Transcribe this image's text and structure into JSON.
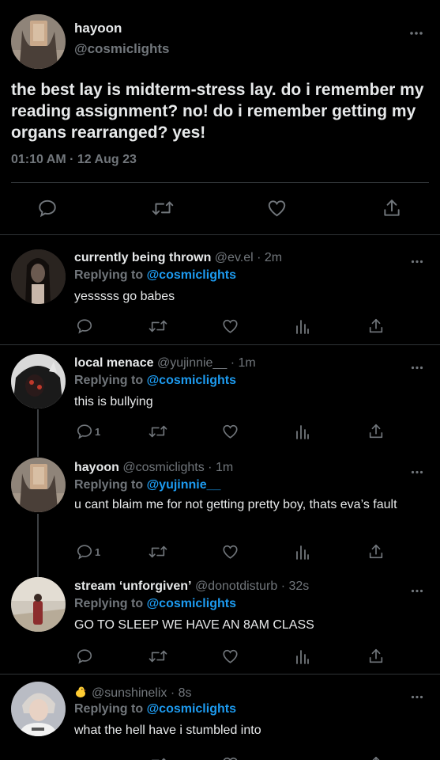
{
  "main_tweet": {
    "name": "hayoon",
    "handle": "@cosmiclights",
    "text": "the best lay is midterm-stress lay. do i remember my reading assignment? no! do i remember getting my organs rearranged? yes!",
    "time": "01:10 AM · 12 Aug 23",
    "more_icon": "more-horizontal-icon",
    "actions": [
      "reply-icon",
      "retweet-icon",
      "like-icon",
      "share-icon"
    ]
  },
  "replies": [
    {
      "name": "currently being thrown",
      "meta": "@ev.el · 2m",
      "replying_label": "Replying to",
      "replying_to": "@cosmiclights",
      "text": "yesssss go babes",
      "reply_count": ""
    },
    {
      "name": "local menace",
      "meta": "@yujinnie__ · 1m",
      "replying_label": "Replying to",
      "replying_to": "@cosmiclights",
      "text": "this is bullying",
      "reply_count": "1"
    },
    {
      "name": "hayoon",
      "meta": "@cosmiclights · 1m",
      "replying_label": "Replying to",
      "replying_to": "@yujinnie__",
      "text": "u cant blaim me for not getting pretty boy, thats eva’s fault",
      "reply_count": "1"
    },
    {
      "name": "stream ‘unforgiven’",
      "meta": "@donotdisturb · 32s",
      "replying_label": "Replying to",
      "replying_to": "@cosmiclights",
      "text": "GO TO SLEEP WE HAVE AN 8AM CLASS",
      "reply_count": ""
    },
    {
      "name": "",
      "meta": "@sunshinelix · 8s",
      "replying_label": "Replying to",
      "replying_to": "@cosmiclights",
      "text": "what the hell have i stumbled into",
      "reply_count": ""
    }
  ],
  "colors": {
    "background": "#000000",
    "text": "#e7e9ea",
    "muted": "#71767b",
    "link": "#1d9bf0",
    "border": "#2f3336"
  }
}
